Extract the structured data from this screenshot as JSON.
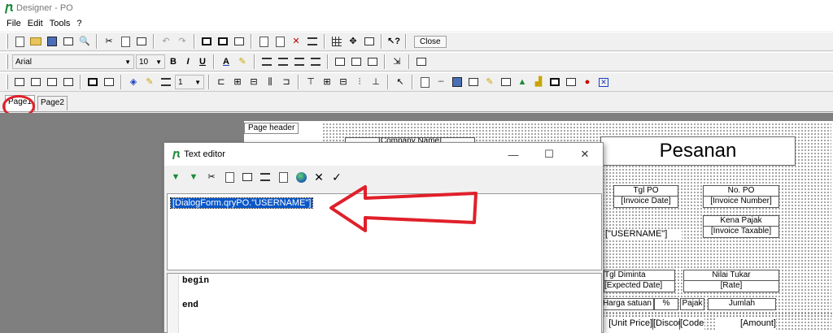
{
  "window": {
    "title": "Designer - PO"
  },
  "menu": {
    "items": [
      "File",
      "Edit",
      "Tools",
      "?"
    ]
  },
  "toolbar": {
    "close_label": "Close",
    "font_name": "Arial",
    "font_size": "10",
    "bold": "B",
    "italic": "I",
    "underline": "U",
    "frame_width": "1"
  },
  "tabs": [
    {
      "label": "Page1",
      "active": true
    },
    {
      "label": "Page2",
      "active": false
    }
  ],
  "report": {
    "band_label": "Page header",
    "company_placeholder": "[Company Name]",
    "title": "Pesanan",
    "tgl_po_label": "Tgl PO",
    "tgl_po_value": "[Invoice Date]",
    "no_po_label": "No. PO",
    "no_po_value": "[Invoice Number]",
    "username_field": "[\"USERNAME\"]",
    "kena_pajak_label": "Kena Pajak",
    "kena_pajak_value": "[Invoice Taxable]",
    "tgl_diminta_label": "Tgl Diminta",
    "tgl_diminta_value": "[Expected Date]",
    "nilai_tukar_label": "Nilai Tukar",
    "nilai_tukar_value": "[Rate]",
    "col_harga_satuan": "Harga satuan",
    "col_percent": "%",
    "col_pajak": "Pajak",
    "col_jumlah": "Jumlah",
    "row_unit_price": "[Unit Price]",
    "row_discount": "[Discount]",
    "row_codes": "[Codes]",
    "row_amount": "[Amount]"
  },
  "text_editor": {
    "title": "Text editor",
    "content": "[DialogForm.qryPO.\"USERNAME\"]",
    "script_lines": [
      "begin",
      "",
      "end"
    ],
    "controls": {
      "minimize": "—",
      "maximize": "☐",
      "close": "✕"
    }
  },
  "annotation": {
    "arrow_color": "#e0202a",
    "circle_color": "#e0202a"
  }
}
